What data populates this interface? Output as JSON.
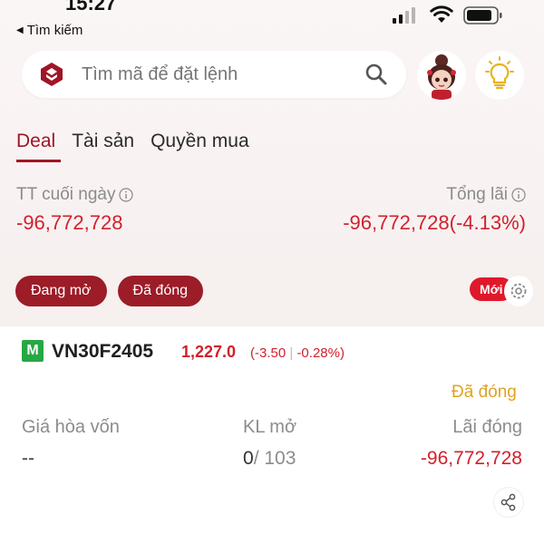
{
  "status_bar": {
    "time": "15:27",
    "back_label": "Tìm kiếm"
  },
  "search": {
    "placeholder": "Tìm mã để đặt lệnh",
    "icon": "search-icon",
    "logo_icon": "brand-logo-icon"
  },
  "header_buttons": {
    "avatar_icon": "avatar",
    "tips_icon": "lightbulb-icon"
  },
  "tabs": [
    {
      "label": "Deal",
      "active": true
    },
    {
      "label": "Tài sản",
      "active": false
    },
    {
      "label": "Quyền mua",
      "active": false
    }
  ],
  "summary": {
    "eod_label": "TT cuối ngày",
    "eod_value": "-96,772,728",
    "total_profit_label": "Tổng lãi",
    "total_profit_value": "-96,772,728(-4.13%)"
  },
  "filters": {
    "open_label": "Đang mở",
    "closed_label": "Đã đóng"
  },
  "new_badge": "Mới",
  "position": {
    "market_badge": "M",
    "ticker": "VN30F2405",
    "price": "1,227.0",
    "change": "(-3.50",
    "change_pct": "-0.28%)",
    "status": "Đã đóng",
    "breakeven_label": "Giá hòa vốn",
    "breakeven_value": "--",
    "open_qty_label": "KL mở",
    "open_qty_value": "0",
    "open_qty_total": "/ 103",
    "closed_pnl_label": "Lãi đóng",
    "closed_pnl_value": "-96,772,728"
  },
  "colors": {
    "brand_dark_red": "#9c1c28",
    "loss_red": "#d0222e",
    "badge_red": "#e0182b",
    "status_gold": "#e0a321",
    "market_green": "#27a844"
  }
}
